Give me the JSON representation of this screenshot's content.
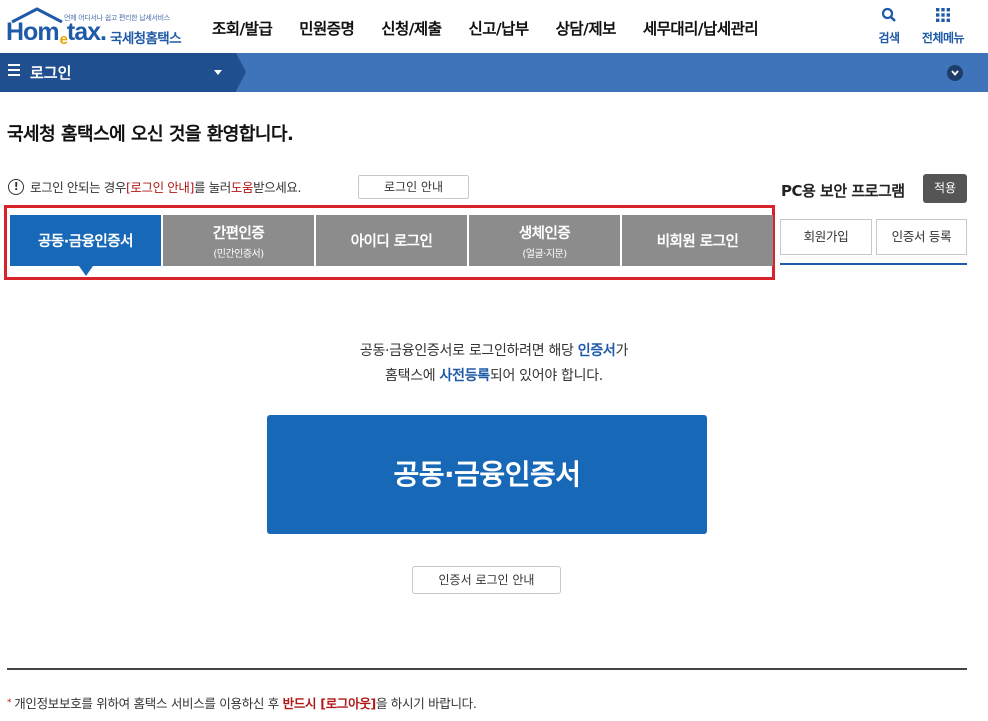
{
  "logo": {
    "tagline": "언제 어디서나 쉽고 편리한 납세서비스",
    "wordmark_left": "Hom",
    "wordmark_e": "e",
    "wordmark_right": "tax.",
    "agency": "국세청홈택스"
  },
  "gnb": [
    "조회/발급",
    "민원증명",
    "신청/제출",
    "신고/납부",
    "상담/제보",
    "세무대리/납세관리"
  ],
  "header_buttons": {
    "search": "검색",
    "all_menu": "전체메뉴"
  },
  "location_bar": {
    "title": "로그인"
  },
  "welcome": "국세청 홈택스에 오신 것을 환영합니다.",
  "notice": {
    "icon_glyph": "!",
    "prefix": "로그인 안되는 경우 ",
    "link_text": "[로그인 안내]",
    "middle": "를 눌러 ",
    "help": "도움",
    "suffix": "받으세요.",
    "button": "로그인 안내"
  },
  "security": {
    "label": "PC용 보안 프로그램",
    "apply": "적용"
  },
  "tabs": [
    {
      "label": "공동·금융인증서",
      "sub": ""
    },
    {
      "label": "간편인증",
      "sub": "(민간인증서)"
    },
    {
      "label": "아이디 로그인",
      "sub": ""
    },
    {
      "label": "생체인증",
      "sub": "(얼굴·지문)"
    },
    {
      "label": "비회원 로그인",
      "sub": ""
    }
  ],
  "side_buttons": {
    "join": "회원가입",
    "cert_register": "인증서 등록"
  },
  "description": {
    "line1_a": "공동·금융인증서로 로그인하려면 해당 ",
    "line1_hl": "인증서",
    "line1_b": "가",
    "line2_a": "홈택스에 ",
    "line2_hl": "사전등록",
    "line2_b": "되어 있어야 합니다."
  },
  "main_button": "공동·금융인증서",
  "cert_guide_button": "인증서 로그인 안내",
  "footnote": {
    "bullet": "*",
    "text_a": "개인정보보호를 위하여 홈택스 서비스를 이용하신 후 ",
    "text_red": "반드시 [로그아웃]",
    "text_b": "을 하시기 바랍니다."
  },
  "colors": {
    "brand_blue": "#1769b8",
    "bar_blue": "#3f74bb",
    "bar_dark": "#1f4f8e",
    "tab_gray": "#8c8c8c",
    "highlight_red": "#d8232a"
  },
  "icons": [
    "home-roof-icon",
    "search-icon",
    "grid-menu-icon",
    "hamburger-icon",
    "caret-down-icon",
    "chevron-down-circle-icon",
    "warning-circle-icon"
  ]
}
